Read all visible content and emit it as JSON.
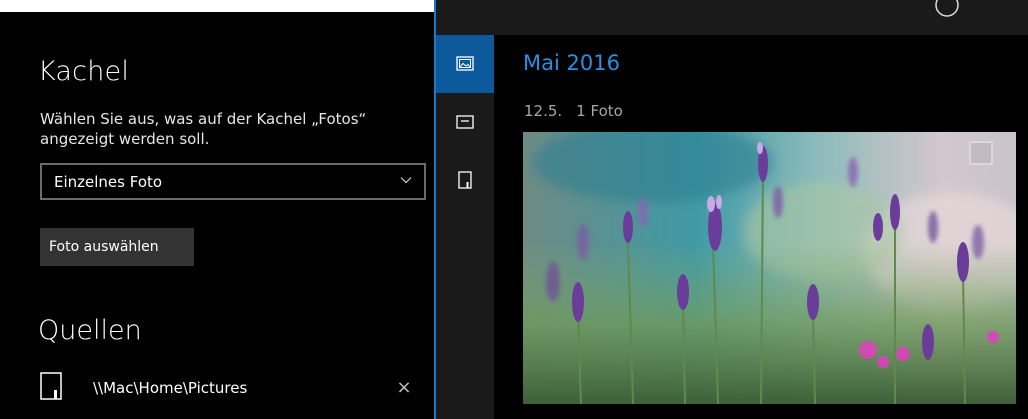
{
  "settings": {
    "tile_section_title": "Kachel",
    "tile_description": "Wählen Sie aus, was auf der Kachel „Fotos“ angezeigt werden soll.",
    "tile_dropdown_value": "Einzelnes Foto",
    "choose_photo_label": "Foto auswählen",
    "sources_section_title": "Quellen",
    "sources": [
      {
        "path": "\\\\Mac\\Home\\Pictures",
        "remove_label": "×"
      }
    ]
  },
  "nav_rail": {
    "items": [
      {
        "icon": "photo-icon",
        "active": true
      },
      {
        "icon": "album-icon",
        "active": false
      },
      {
        "icon": "folder-icon",
        "active": false
      }
    ]
  },
  "gallery": {
    "month_heading": "Mai 2016",
    "date": "12.5.",
    "count": "1 Foto"
  },
  "colors": {
    "accent": "#1e78c8",
    "month_text": "#2b8ee0",
    "nav_active": "#0c5a9c"
  }
}
